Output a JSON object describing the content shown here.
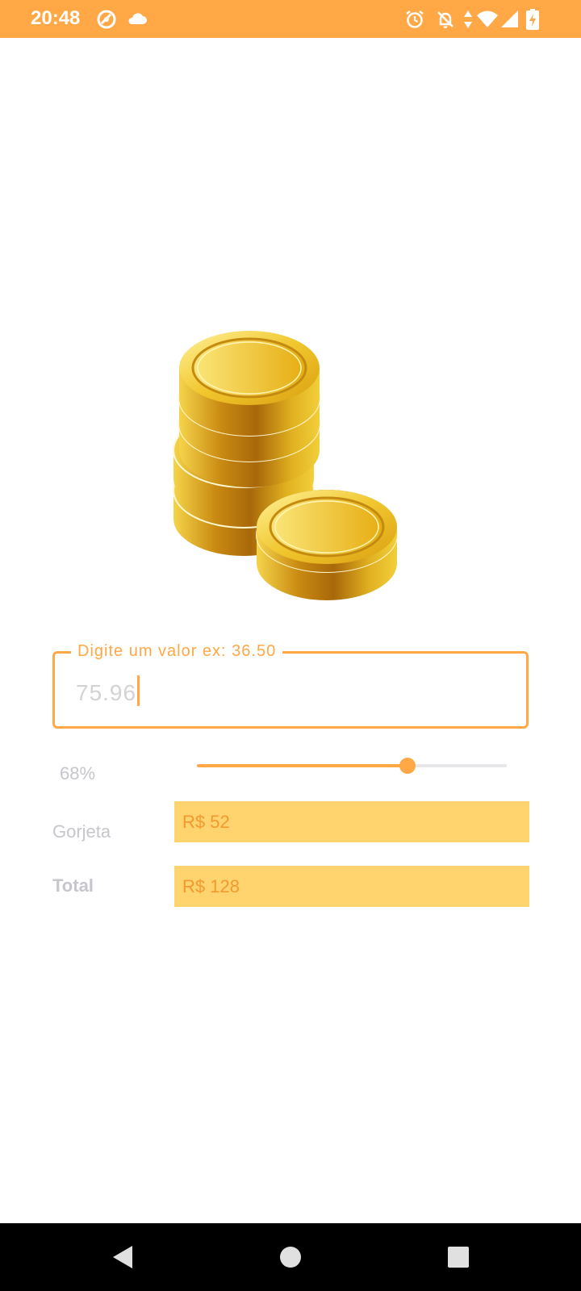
{
  "status_bar": {
    "time": "20:48",
    "icons": [
      "data-saver-icon",
      "cloud-icon",
      "alarm-icon",
      "notifications-off-icon",
      "data-arrows-icon",
      "wifi-icon",
      "signal-icon",
      "battery-charging-icon"
    ],
    "background_color": "#ffa845"
  },
  "illustration": {
    "name": "gold-coins-image"
  },
  "amount_input": {
    "label": "Digite um valor ex: 36.50",
    "value": "75.96",
    "accent_color": "#ffa845"
  },
  "tip_slider": {
    "percent_label": "68%",
    "value": 68
  },
  "tip": {
    "label": "Gorjeta",
    "value": "R$ 52"
  },
  "total": {
    "label": "Total",
    "value": "R$ 128"
  },
  "colors": {
    "accent": "#ffa845",
    "result_background": "#ffd36e",
    "result_text": "#f39a2e",
    "label_text": "#c6c6cc"
  },
  "nav_bar": {
    "icons": [
      "back-icon",
      "home-icon",
      "recents-icon"
    ]
  }
}
